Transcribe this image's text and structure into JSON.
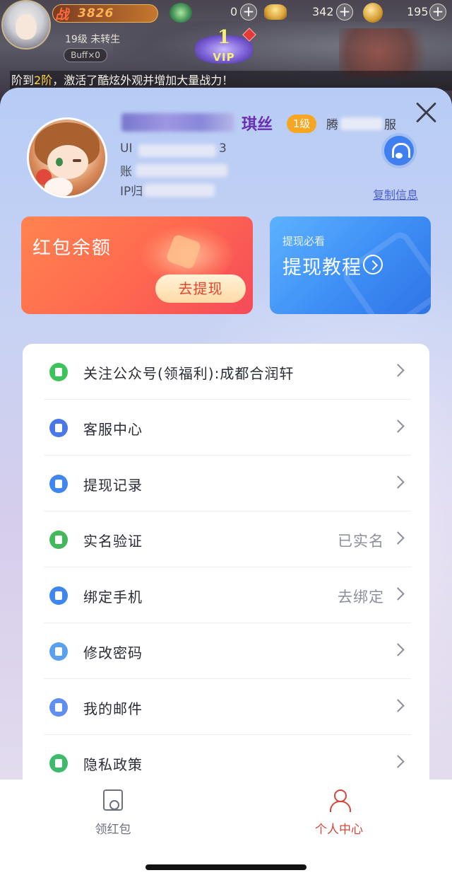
{
  "game": {
    "power_icon_text": "战",
    "power_value": "3826",
    "jade_count": "0",
    "ingot_count": "342",
    "coin_count": "195",
    "level_text": "19级 未转生",
    "buff_text": "Buff×0",
    "vip_level": "1",
    "vip_label": "VIP",
    "ticker_prefix": "阶到",
    "ticker_highlight": "2阶",
    "ticker_suffix": "，激活了酷炫外观并增加大量战力！"
  },
  "profile": {
    "name": "琪丝",
    "level_badge": "1级",
    "server_prefix": "腾",
    "server_suffix": "服",
    "uid_prefix": "UI",
    "uid_suffix": "3",
    "account_prefix": "账",
    "ip_prefix": "IP归",
    "copy_label": "复制信息"
  },
  "cards": {
    "redpack_title": "红包余额",
    "withdraw_button": "去提现",
    "tutorial_subtitle": "提现必看",
    "tutorial_title": "提现教程"
  },
  "menu": {
    "items": [
      {
        "label": "关注公众号(领福利):成都合润轩",
        "value": "",
        "icon": "wechat-icon",
        "color": "#3cc45a"
      },
      {
        "label": "客服中心",
        "value": "",
        "icon": "headset-icon",
        "color": "#4a78e8"
      },
      {
        "label": "提现记录",
        "value": "",
        "icon": "document-icon",
        "color": "#3f86ee"
      },
      {
        "label": "实名验证",
        "value": "已实名",
        "icon": "verified-icon",
        "color": "#43b95c"
      },
      {
        "label": "绑定手机",
        "value": "去绑定",
        "icon": "phone-icon",
        "color": "#3f86ee"
      },
      {
        "label": "修改密码",
        "value": "",
        "icon": "edit-icon",
        "color": "#5aa0f0"
      },
      {
        "label": "我的邮件",
        "value": "",
        "icon": "mail-icon",
        "color": "#5d8ef0"
      },
      {
        "label": "隐私政策",
        "value": "",
        "icon": "privacy-icon",
        "color": "#3fb96a"
      }
    ]
  },
  "tabbar": {
    "tab1_label": "领红包",
    "tab2_label": "个人中心",
    "inactive_color": "#6d7080",
    "active_color": "#d8453a"
  }
}
